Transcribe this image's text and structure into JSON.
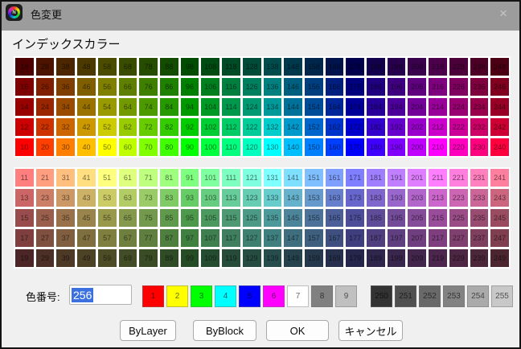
{
  "window": {
    "title": "色変更",
    "close_glyph": "×"
  },
  "palette": {
    "section_label": "インデックスカラー",
    "top_rows": [
      [
        18,
        28,
        38,
        48,
        58,
        68,
        78,
        88,
        98,
        108,
        118,
        128,
        138,
        148,
        158,
        168,
        178,
        188,
        198,
        208,
        218,
        228,
        238,
        248
      ],
      [
        16,
        26,
        36,
        46,
        56,
        66,
        76,
        86,
        96,
        106,
        116,
        126,
        136,
        146,
        156,
        166,
        176,
        186,
        196,
        206,
        216,
        226,
        236,
        246
      ],
      [
        14,
        24,
        34,
        44,
        54,
        64,
        74,
        84,
        94,
        104,
        114,
        124,
        134,
        144,
        154,
        164,
        174,
        184,
        194,
        204,
        214,
        224,
        234,
        244
      ],
      [
        12,
        22,
        32,
        42,
        52,
        62,
        72,
        82,
        92,
        102,
        112,
        122,
        132,
        142,
        152,
        162,
        172,
        182,
        192,
        202,
        212,
        222,
        232,
        242
      ],
      [
        10,
        20,
        30,
        40,
        50,
        60,
        70,
        80,
        90,
        100,
        110,
        120,
        130,
        140,
        150,
        160,
        170,
        180,
        190,
        200,
        210,
        220,
        230,
        240
      ]
    ],
    "bottom_rows": [
      [
        11,
        21,
        31,
        41,
        51,
        61,
        71,
        81,
        91,
        101,
        111,
        121,
        131,
        141,
        151,
        161,
        171,
        181,
        191,
        201,
        211,
        221,
        231,
        241
      ],
      [
        13,
        23,
        33,
        43,
        53,
        63,
        73,
        83,
        93,
        103,
        113,
        123,
        133,
        143,
        153,
        163,
        173,
        183,
        193,
        203,
        213,
        223,
        233,
        243
      ],
      [
        15,
        25,
        35,
        45,
        55,
        65,
        75,
        85,
        95,
        105,
        115,
        125,
        135,
        145,
        155,
        165,
        175,
        185,
        195,
        205,
        215,
        225,
        235,
        245
      ],
      [
        17,
        27,
        37,
        47,
        57,
        67,
        77,
        87,
        97,
        107,
        117,
        127,
        137,
        147,
        157,
        167,
        177,
        187,
        197,
        207,
        217,
        227,
        237,
        247
      ],
      [
        19,
        29,
        39,
        49,
        59,
        69,
        79,
        89,
        99,
        109,
        119,
        129,
        139,
        149,
        159,
        169,
        179,
        189,
        199,
        209,
        219,
        229,
        239,
        249
      ]
    ],
    "standard_colors": [
      1,
      2,
      3,
      4,
      5,
      6,
      7,
      8,
      9
    ],
    "gray_colors": [
      250,
      251,
      252,
      253,
      254,
      255
    ],
    "special_hex": {
      "1": "#ff0000",
      "2": "#ffff00",
      "3": "#00ff00",
      "4": "#00ffff",
      "5": "#0000ff",
      "6": "#ff00ff",
      "7": "#ffffff",
      "8": "#808080",
      "9": "#c0c0c0",
      "250": "#333333",
      "251": "#505050",
      "252": "#696969",
      "253": "#828282",
      "254": "#aaaaaa",
      "255": "#c8c8c8"
    }
  },
  "color_number": {
    "label": "色番号:",
    "value": "256",
    "selection_color": "#3b70e0"
  },
  "buttons": {
    "bylayer": "ByLayer",
    "byblock": "ByBlock",
    "ok": "OK",
    "cancel": "キャンセル"
  },
  "colors": {
    "titlebar_bg": "#9c9c9c",
    "dialog_bg": "#f0f0f0",
    "grid_gap": "#ffffff"
  }
}
